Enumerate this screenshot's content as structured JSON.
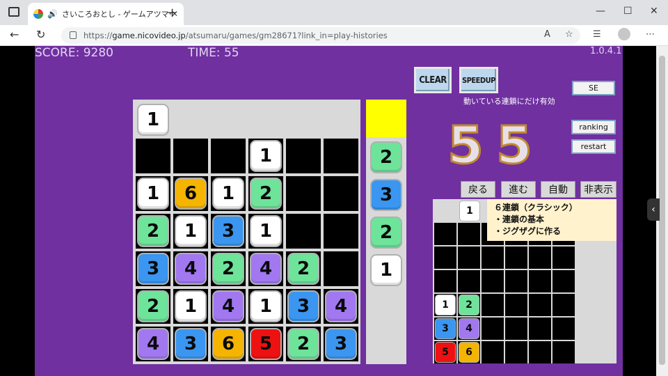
{
  "browser": {
    "tab_title": "さいころおとし - ゲームアツマール",
    "url_host": "game.nicovideo.jp",
    "url_prefix": "https://",
    "url_path": "/atsumaru/games/gm28671?link_in=play-histories"
  },
  "hud": {
    "score_label": "SCORE: 9280",
    "time_label": "TIME: 55",
    "version": "1.0.4.1"
  },
  "buttons": {
    "clear": "CLEAR",
    "speedup": "SPEEDUP",
    "speedup_hint": "動いている連鎖にだけ有効",
    "se": "SE",
    "ranking": "ranking",
    "restart": "restart"
  },
  "chain_display": [
    "5",
    "5"
  ],
  "replay_controls": [
    "戻る",
    "進む",
    "自動",
    "非表示"
  ],
  "tutorial": {
    "title": "６連鎖（クラシック）",
    "line1": "・連鎖の基本",
    "line2": "・ジグザグに作る"
  },
  "colors": {
    "1": "#ffffff",
    "2": "#6ee39a",
    "3": "#3a96f0",
    "4": "#a278f0",
    "5": "#ee1111",
    "6": "#f5b400"
  },
  "board": {
    "falling": [
      1
    ],
    "rows": [
      [
        0,
        0,
        0,
        1,
        0,
        0
      ],
      [
        1,
        6,
        1,
        2,
        0,
        0
      ],
      [
        2,
        1,
        3,
        1,
        0,
        0
      ],
      [
        3,
        4,
        2,
        4,
        2,
        0
      ],
      [
        2,
        1,
        4,
        1,
        3,
        4
      ],
      [
        4,
        3,
        6,
        5,
        2,
        3
      ]
    ]
  },
  "next_queue": [
    2,
    3,
    2,
    1
  ],
  "mini_board": {
    "falling": [
      1
    ],
    "rows": [
      [
        0,
        0,
        0,
        0,
        0,
        0
      ],
      [
        0,
        0,
        0,
        0,
        0,
        0
      ],
      [
        0,
        0,
        0,
        0,
        0,
        0
      ],
      [
        1,
        2,
        0,
        0,
        0,
        0
      ],
      [
        3,
        4,
        0,
        0,
        0,
        0
      ],
      [
        5,
        6,
        0,
        0,
        0,
        0
      ]
    ]
  }
}
